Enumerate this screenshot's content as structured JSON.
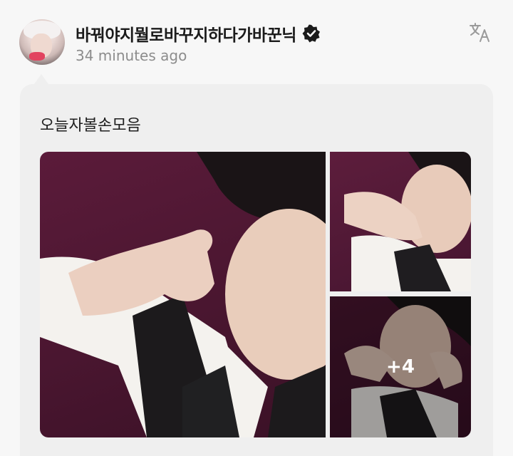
{
  "post": {
    "username": "바꿔야지뭘로바꾸지하다가바꾼닉",
    "verified": true,
    "time_ago": "34 minutes ago",
    "text": "오늘자볼손모음",
    "photos": {
      "more_count": "+4"
    }
  },
  "icons": {
    "verified": "verified-badge-icon",
    "translate": "translate-icon"
  },
  "colors": {
    "background": "#f7f7f7",
    "bubble": "#efefef",
    "username": "#1b1b1b",
    "time": "#8c8c8c"
  }
}
